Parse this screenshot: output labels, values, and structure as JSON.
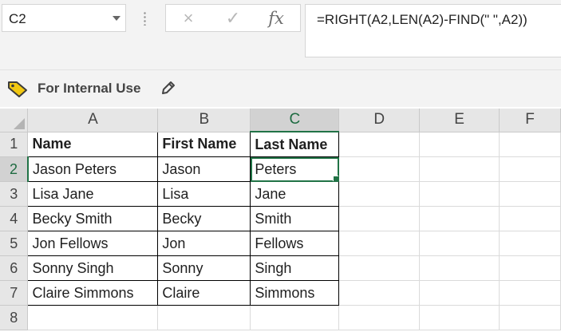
{
  "formula_bar": {
    "name_box": "C2",
    "cancel_icon": "×",
    "enter_icon": "✓",
    "fx_label": "fx",
    "formula": "=RIGHT(A2,LEN(A2)-FIND(\" \",A2))"
  },
  "sensitivity": {
    "label": "For Internal Use",
    "icon": "tag-icon",
    "edit_icon": "pencil-icon",
    "tag_color": "#f2c811"
  },
  "grid": {
    "columns": [
      "A",
      "B",
      "C",
      "D",
      "E",
      "F"
    ],
    "rows": [
      "1",
      "2",
      "3",
      "4",
      "5",
      "6",
      "7",
      "8"
    ],
    "selected_cell": "C2",
    "accent_color": "#217346",
    "cells": [
      [
        "Name",
        "First Name",
        "Last Name"
      ],
      [
        "Jason Peters",
        "Jason",
        "Peters"
      ],
      [
        "Lisa Jane",
        "Lisa",
        "Jane"
      ],
      [
        "Becky Smith",
        "Becky",
        "Smith"
      ],
      [
        "Jon Fellows",
        "Jon",
        "Fellows"
      ],
      [
        "Sonny Singh",
        "Sonny",
        "Singh"
      ],
      [
        "Claire Simmons",
        "Claire",
        "Simmons"
      ],
      [
        "",
        "",
        ""
      ]
    ]
  }
}
